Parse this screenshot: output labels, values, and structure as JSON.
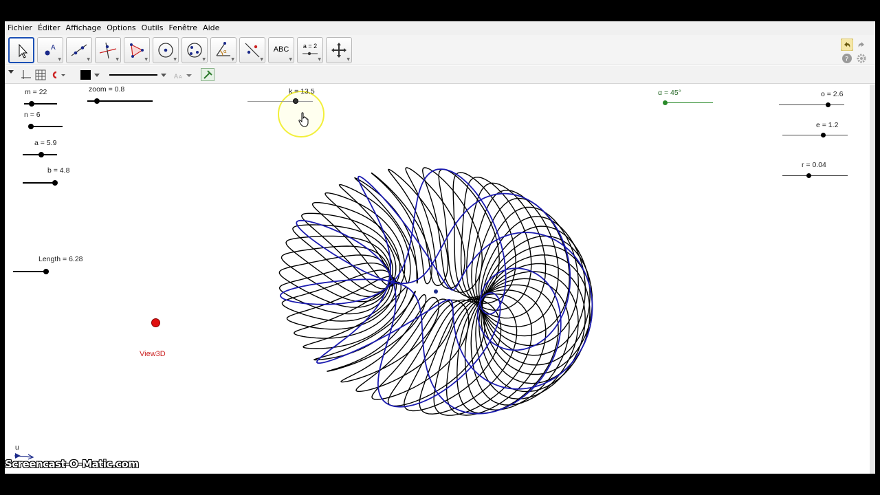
{
  "menu": [
    "Fichier",
    "Éditer",
    "Affichage",
    "Options",
    "Outils",
    "Fenêtre",
    "Aide"
  ],
  "toolbar": {
    "tools": [
      {
        "name": "move-tool",
        "icon": "arrow-cursor-icon"
      },
      {
        "name": "point-tool",
        "icon": "point-icon"
      },
      {
        "name": "line-tool",
        "icon": "line-icon"
      },
      {
        "name": "perpendicular-tool",
        "icon": "perpendicular-icon"
      },
      {
        "name": "polygon-tool",
        "icon": "polygon-icon"
      },
      {
        "name": "circle-tool",
        "icon": "circle-center-icon"
      },
      {
        "name": "ellipse-tool",
        "icon": "conic-icon"
      },
      {
        "name": "angle-tool",
        "icon": "angle-icon"
      },
      {
        "name": "reflect-tool",
        "icon": "reflect-icon"
      },
      {
        "name": "text-tool",
        "icon": "text-icon",
        "label": "ABC"
      },
      {
        "name": "slider-tool",
        "icon": "slider-icon",
        "label": "a = 2"
      },
      {
        "name": "move-view-tool",
        "icon": "move-graphics-icon"
      }
    ]
  },
  "sliders": {
    "m": {
      "label": "m = 22",
      "value": 22
    },
    "zoom": {
      "label": "zoom = 0.8",
      "value": 0.8
    },
    "k": {
      "label": "k = 13.5",
      "value": 13.5
    },
    "alpha": {
      "label": "α = 45°",
      "value": 45
    },
    "o": {
      "label": "o = 2.6",
      "value": 2.6
    },
    "n": {
      "label": "n = 6",
      "value": 6
    },
    "e": {
      "label": "e = 1.2",
      "value": 1.2
    },
    "a": {
      "label": "a = 5.9",
      "value": 5.9
    },
    "b": {
      "label": "b = 4.8",
      "value": 4.8
    },
    "r": {
      "label": "r = 0.04",
      "value": 0.04
    },
    "length": {
      "label": "Length = 6.28",
      "value": 6.28
    }
  },
  "view3d_label": "View3D",
  "axis_label": "u",
  "watermark": "Screencast-O-Matic.com",
  "colors": {
    "torus_black": "#000000",
    "torus_blue": "#1b1bb0",
    "red_point": "#e01010",
    "highlight": "#f2ef3a",
    "selected_tool": "#1a4fb5"
  }
}
